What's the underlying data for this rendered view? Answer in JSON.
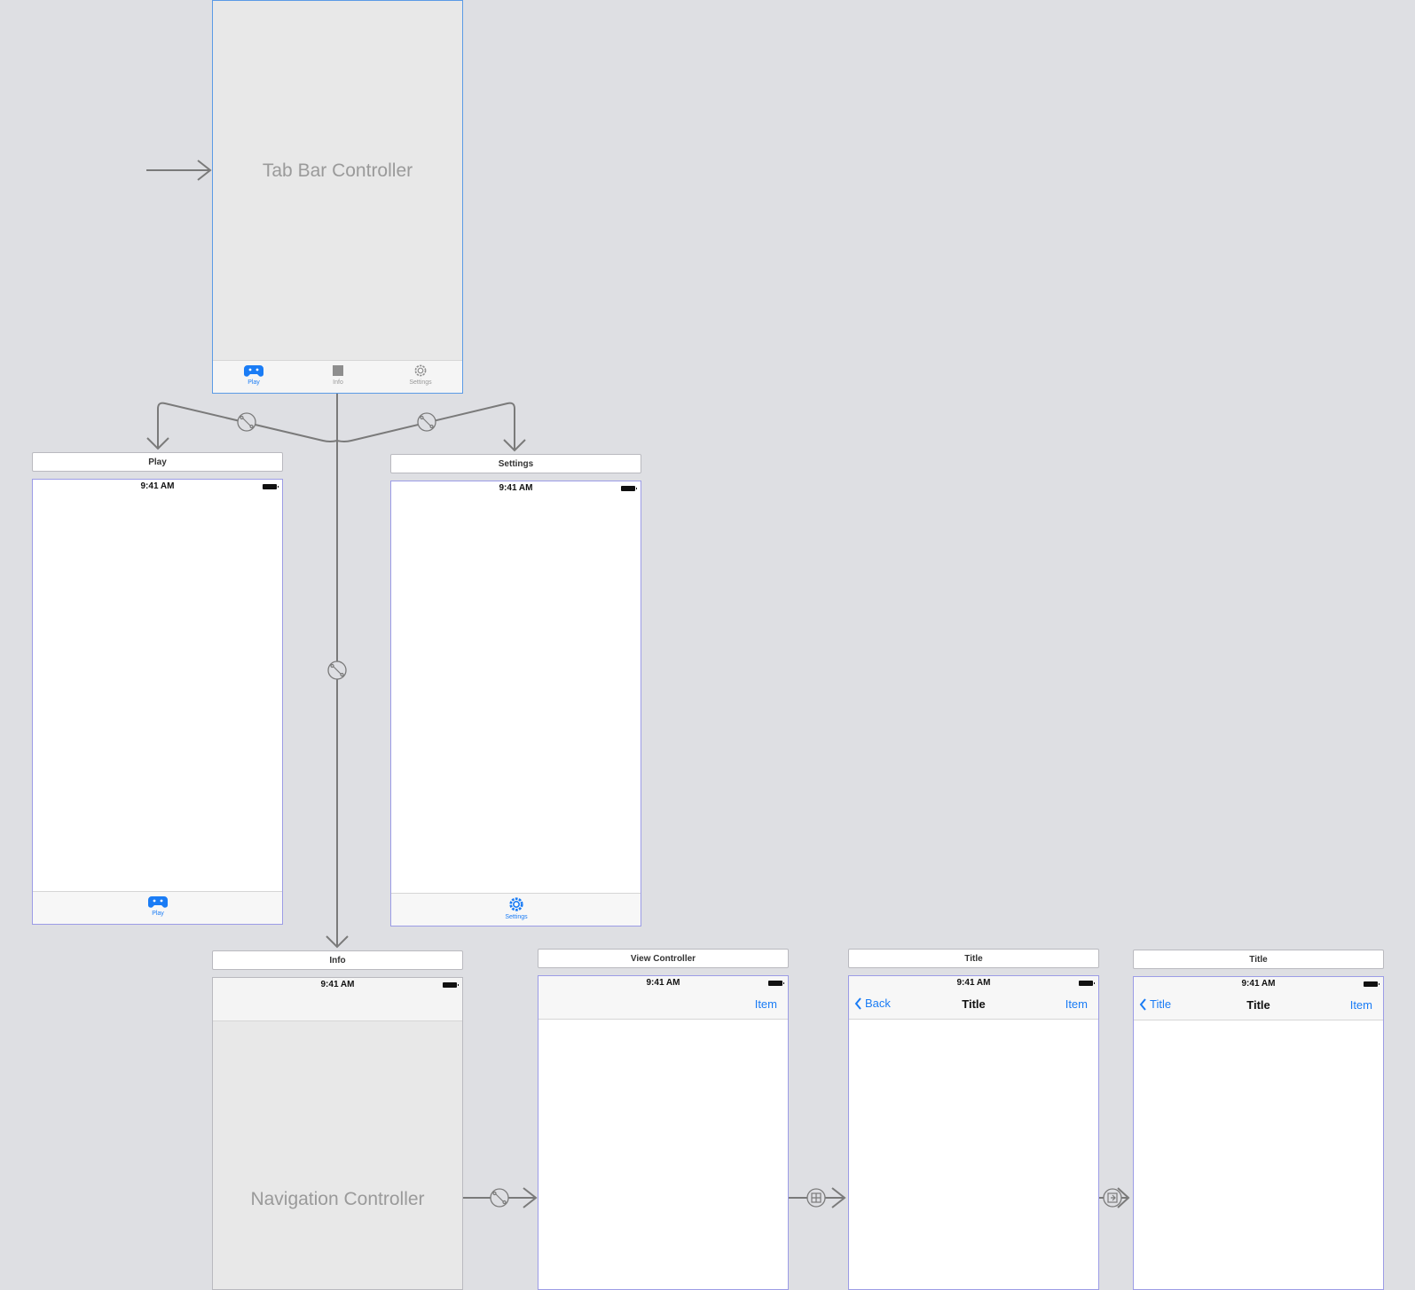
{
  "tab_bar_controller": {
    "label": "Tab Bar Controller",
    "tabs": [
      {
        "label": "Play",
        "icon": "gamepad-icon",
        "active": true
      },
      {
        "label": "Info",
        "icon": "square-icon",
        "active": false
      },
      {
        "label": "Settings",
        "icon": "gear-icon",
        "active": false
      }
    ]
  },
  "play_scene": {
    "title": "Play",
    "time": "9:41 AM",
    "tab_label": "Play"
  },
  "settings_scene": {
    "title": "Settings",
    "time": "9:41 AM",
    "tab_label": "Settings"
  },
  "info_scene": {
    "title": "Info",
    "time": "9:41 AM",
    "label": "Navigation Controller"
  },
  "view_controller_scene": {
    "title": "View Controller",
    "time": "9:41 AM",
    "right_item": "Item"
  },
  "title_scene_1": {
    "title": "Title",
    "time": "9:41 AM",
    "back": "Back",
    "nav_title": "Title",
    "right_item": "Item"
  },
  "title_scene_2": {
    "title": "Title",
    "time": "9:41 AM",
    "back": "Title",
    "nav_title": "Title",
    "right_item": "Item"
  },
  "colors": {
    "canvas": "#dedfe3",
    "accent": "#1a7cf5",
    "segue_line": "#7a7a7a"
  }
}
